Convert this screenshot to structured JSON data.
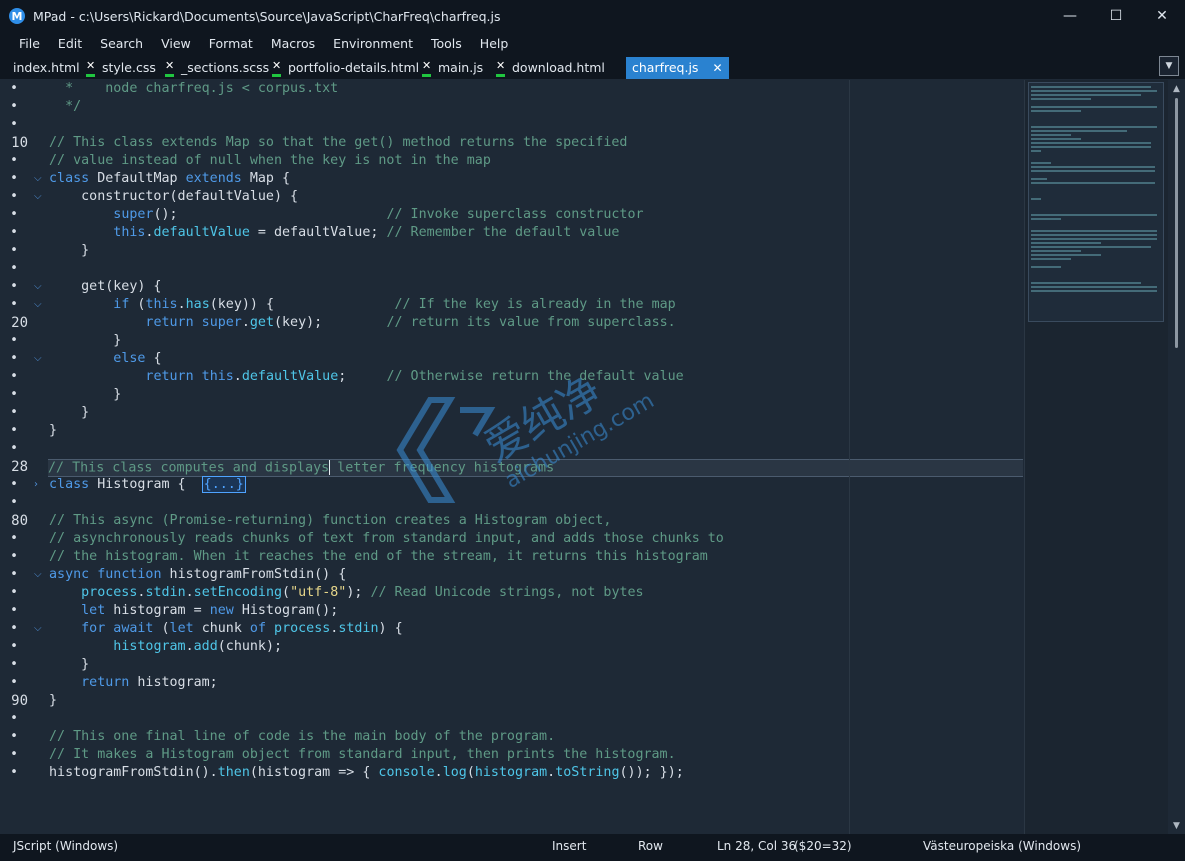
{
  "window": {
    "app_icon_letter": "M",
    "title": "MPad - c:\\Users\\Rickard\\Documents\\Source\\JavaScript\\CharFreq\\charfreq.js",
    "minimize_glyph": "—",
    "maximize_glyph": "☐",
    "close_glyph": "✕"
  },
  "menu": [
    "File",
    "Edit",
    "Search",
    "View",
    "Format",
    "Macros",
    "Environment",
    "Tools",
    "Help"
  ],
  "tabs": [
    {
      "label": "index.html",
      "modified": false
    },
    {
      "label": "style.css",
      "modified": true
    },
    {
      "label": "_sections.scss",
      "modified": true
    },
    {
      "label": "portfolio-details.html",
      "modified": true
    },
    {
      "label": "main.js",
      "modified": true
    },
    {
      "label": "download.html",
      "modified": true
    },
    {
      "label": "charfreq.js",
      "active": true
    }
  ],
  "tab_close_glyph": "✕",
  "tab_dropdown_glyph": "▼",
  "gutter": {
    "dot": "•",
    "numbers": [
      "10",
      "20",
      "28",
      "80",
      "90"
    ]
  },
  "watermark": {
    "text": "爱纯净",
    "url": "aichunjing.com"
  },
  "statusbar": {
    "language": "JScript (Windows)",
    "mode": "Insert",
    "selection_mode": "Row",
    "position": "Ln 28, Col 36",
    "char_info": "($20=32)",
    "encoding": "Västeuropeiska (Windows)"
  },
  "colors": {
    "background": "#1e2936",
    "chrome": "#0f161f",
    "accent": "#2a82d0",
    "comment": "#5f9a86",
    "keyword": "#4f9ae8",
    "string": "#e6d68a",
    "modified_marker": "#20c640"
  }
}
